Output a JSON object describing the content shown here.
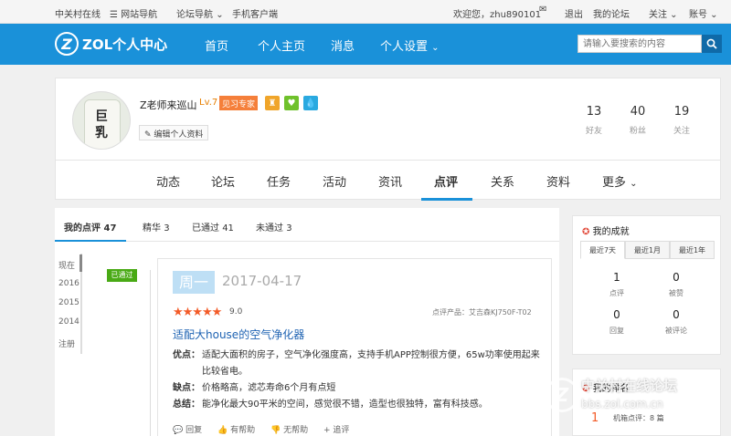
{
  "topbar": {
    "site": "中关村在线",
    "nav1": "网站导航",
    "nav2": "论坛导航",
    "mobile": "手机客户端",
    "welcome": "欢迎您，zhu890101",
    "logout": "退出",
    "myforum": "我的论坛",
    "follow": "关注",
    "account": "账号"
  },
  "header": {
    "logo_mark": "Z",
    "logo_text": "ZOL个人中心",
    "nav": [
      "首页",
      "个人主页",
      "消息",
      "个人设置"
    ],
    "search_placeholder": "请输入要搜索的内容"
  },
  "profile": {
    "avatar_text": [
      "巨",
      "乳"
    ],
    "name": "Z老师来巡山",
    "level": "Lv.7",
    "badge": "见习专家",
    "edit": "编辑个人资料",
    "stats": [
      {
        "value": "13",
        "label": "好友"
      },
      {
        "value": "40",
        "label": "粉丝"
      },
      {
        "value": "19",
        "label": "关注"
      }
    ]
  },
  "tabs": [
    "动态",
    "论坛",
    "任务",
    "活动",
    "资讯",
    "点评",
    "关系",
    "资料",
    "更多"
  ],
  "subtabs": [
    {
      "label": "我的点评",
      "count": "47"
    },
    {
      "label": "精华",
      "count": "3"
    },
    {
      "label": "已通过",
      "count": "41"
    },
    {
      "label": "未通过",
      "count": "3"
    }
  ],
  "years": [
    "现在",
    "2016",
    "2015",
    "2014",
    "注册"
  ],
  "review": {
    "status": "已通过",
    "day": "周一",
    "date": "2017-04-17",
    "stars": "★★★★★",
    "score": "9.0",
    "product_label": "点评产品：艾吉森KJ750F-T02",
    "title": "适配大house的空气净化器",
    "pros_label": "优点：",
    "pros": "适配大面积的房子，空气净化强度高，支持手机APP控制很方便，65w功率使用起来比较省电。",
    "cons_label": "缺点：",
    "cons": "价格略高，滤芯寿命6个月有点短",
    "summary_label": "总结：",
    "summary": "能净化最大90平米的空间，感觉很不错，造型也很独特，富有科技感。",
    "actions": [
      "回复",
      "有帮助",
      "无帮助",
      "追评"
    ]
  },
  "achievements": {
    "title": "我的成就",
    "ranges": [
      "最近7天",
      "最近1月",
      "最近1年"
    ],
    "items": [
      {
        "value": "1",
        "label": "点评"
      },
      {
        "value": "0",
        "label": "被赞"
      },
      {
        "value": "0",
        "label": "回复"
      },
      {
        "value": "0",
        "label": "被评论"
      }
    ]
  },
  "ranking": {
    "title": "我的排名",
    "rank": "1",
    "text": "机箱点评：8 篇"
  },
  "watermark": {
    "line1": "中关村在线论坛",
    "line2": "bbs.zol.com.cn"
  },
  "colors": {
    "accent": "#1a91d9",
    "status_green": "#49aa15",
    "star": "#f35b28"
  }
}
